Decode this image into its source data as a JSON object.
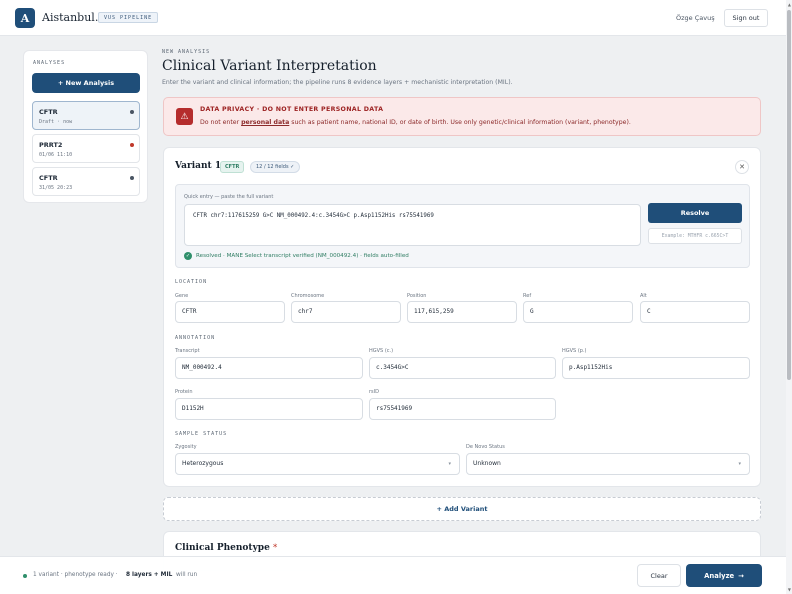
{
  "header": {
    "logo_letter": "A",
    "brand": "Aistanbul.",
    "badge": "VUS PIPELINE",
    "user_name": "Özge Çavuş",
    "signout_label": "Sign out"
  },
  "sidebar": {
    "title": "ANALYSES",
    "new_label": "+ New Analysis",
    "items": [
      {
        "name": "CFTR",
        "sub": "Draft · now",
        "dot_color": "#4a5563"
      },
      {
        "name": "PRRT2",
        "sub": "01/06 11:10",
        "dot_color": "#c0392b"
      },
      {
        "name": "CFTR",
        "sub": "31/05 20:23",
        "dot_color": "#4a5563"
      }
    ]
  },
  "main": {
    "eyebrow": "NEW ANALYSIS",
    "title": "Clinical Variant Interpretation",
    "description": "Enter the variant and clinical information; the pipeline runs 8 evidence layers + mechanistic interpretation (MIL)."
  },
  "alert": {
    "icon": "warning-icon",
    "title": "DATA PRIVACY · DO NOT ENTER PERSONAL DATA",
    "text_before": "Do not enter ",
    "text_emph": "personal data",
    "text_after": " such as patient name, national ID, or date of birth. Use only genetic/clinical information (variant, phenotype)."
  },
  "variant": {
    "title": "Variant 1",
    "gene_badge": "CFTR",
    "fields_badge": "12 / 12 fields ✓",
    "close_icon": "✕",
    "quick_label": "Quick entry — paste the full variant",
    "quick_value": "CFTR chr7:117615259 G>C NM_000492.4:c.3454G>C p.Asp1152His rs75541969",
    "resolve_label": "Resolve",
    "example_label": "Example: MTHFR c.665C>T",
    "resolved_text": "Resolved · MANE Select transcript verified (NM_000492.4) · fields auto-filled",
    "location": {
      "label": "LOCATION",
      "gene_label": "Gene",
      "gene": "CFTR",
      "chrom_label": "Chromosome",
      "chrom": "chr7",
      "pos_label": "Position",
      "pos": "117,615,259",
      "ref_label": "Ref",
      "ref": "G",
      "alt_label": "Alt",
      "alt": "C"
    },
    "annotation": {
      "label": "ANNOTATION",
      "transcript_label": "Transcript",
      "transcript": "NM_000492.4",
      "hgvs_c_label": "HGVS (c.)",
      "hgvs_c": "c.3454G>C",
      "hgvs_p_label": "HGVS (p.)",
      "hgvs_p": "p.Asp1152His",
      "protein_label": "Protein",
      "protein": "D1152H",
      "rsid_label": "rsID",
      "rsid": "rs75541969"
    },
    "sample": {
      "label": "SAMPLE STATUS",
      "zygosity_label": "Zygosity",
      "zygosity": "Heterozygous",
      "denovo_label": "De Novo Status",
      "denovo": "Unknown"
    }
  },
  "add_variant_label": "+ Add Variant",
  "phenotype": {
    "title": "Clinical Phenotype",
    "required_mark": "*"
  },
  "footer": {
    "status": "1 variant · phenotype ready ·",
    "layers": "8 layers + MIL",
    "run": "will run",
    "clear_label": "Clear",
    "analyze_label": "Analyze",
    "analyze_arrow": "→"
  },
  "colors": {
    "primary": "#1f4e79",
    "danger": "#b52c2c",
    "success": "#2f8f6b"
  }
}
